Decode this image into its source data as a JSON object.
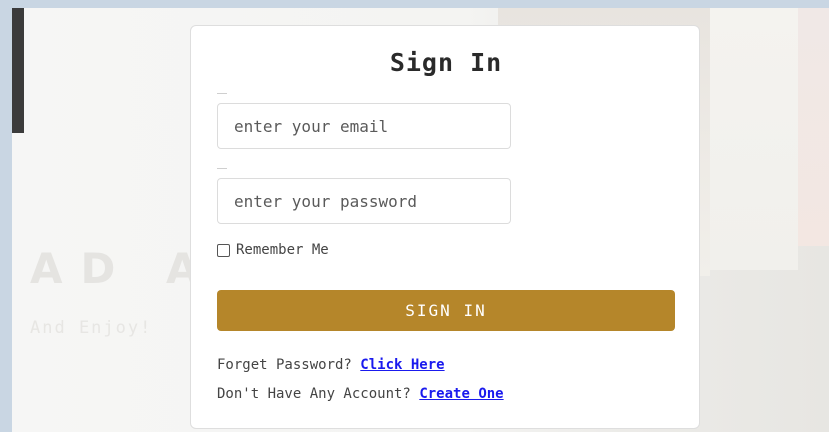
{
  "hero": {
    "title": "AD A B",
    "subtitle": "And Enjoy!"
  },
  "signin_card": {
    "title": "Sign In",
    "email_placeholder": "enter your email",
    "password_placeholder": "enter your password",
    "remember_label": "Remember Me",
    "remember_checked": false,
    "submit_label": "SIGN IN",
    "forgot_prompt": "Forget Password?",
    "forgot_link": "Click Here",
    "signup_prompt": "Don't Have Any Account?",
    "signup_link": "Create One"
  },
  "colors": {
    "button_bg": "#b5862a",
    "link": "#1a1aee",
    "page_bg": "#c9d6e3"
  }
}
